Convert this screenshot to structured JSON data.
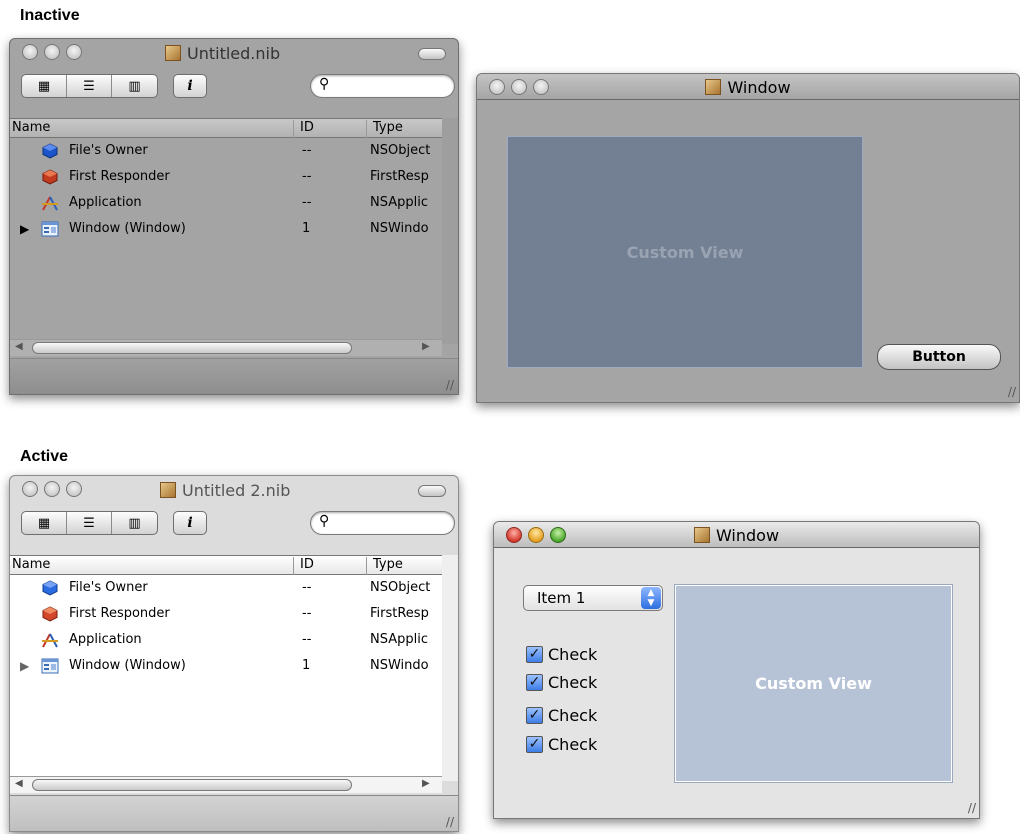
{
  "sections": {
    "inactive": "Inactive",
    "active": "Active"
  },
  "nib_columns": {
    "name": "Name",
    "id": "ID",
    "type": "Type"
  },
  "nib_inactive": {
    "title": "Untitled.nib",
    "rows": [
      {
        "name": "File's Owner",
        "id": "--",
        "type": "NSObject",
        "icon": "cube-icon"
      },
      {
        "name": "First Responder",
        "id": "--",
        "type": "FirstResp",
        "icon": "first-responder-icon"
      },
      {
        "name": "Application",
        "id": "--",
        "type": "NSApplic",
        "icon": "application-icon"
      },
      {
        "name": "Window (Window)",
        "id": "1",
        "type": "NSWindo",
        "icon": "window-icon"
      }
    ]
  },
  "nib_active": {
    "title": "Untitled 2.nib",
    "rows": [
      {
        "name": "File's Owner",
        "id": "--",
        "type": "NSObject",
        "icon": "cube-icon"
      },
      {
        "name": "First Responder",
        "id": "--",
        "type": "FirstResp",
        "icon": "first-responder-icon"
      },
      {
        "name": "Application",
        "id": "--",
        "type": "NSApplic",
        "icon": "application-icon"
      },
      {
        "name": "Window (Window)",
        "id": "1",
        "type": "NSWindo",
        "icon": "window-icon"
      }
    ]
  },
  "window_inactive": {
    "title": "Window",
    "custom_view_label": "Custom View",
    "button_label": "Button",
    "custom_view_color": "#737f93"
  },
  "window_active": {
    "title": "Window",
    "popup_value": "Item 1",
    "checkboxes": [
      "Check",
      "Check",
      "Check",
      "Check"
    ],
    "custom_view_label": "Custom View",
    "custom_view_color": "#b6c3d6"
  }
}
